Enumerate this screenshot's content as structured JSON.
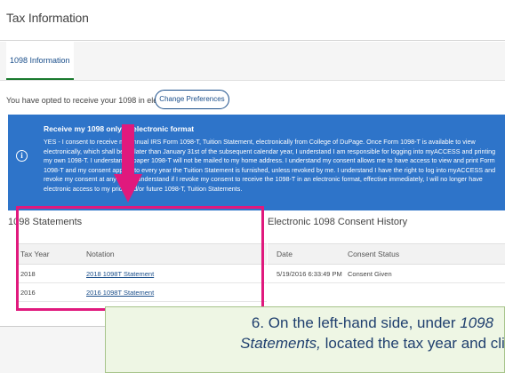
{
  "header": {
    "title": "Tax Information"
  },
  "tabs": [
    {
      "label": "1098 Information"
    }
  ],
  "opt_in": {
    "text": "You have opted to receive your 1098 in electronic format:",
    "button_label": "Change Preferences"
  },
  "consent": {
    "icon": "info-icon",
    "heading": "Receive my 1098 only in electronic format",
    "body": "YES - I consent to receive my annual IRS Form 1098-T, Tuition Statement, electronically from College of DuPage. Once Form 1098-T is available to view electronically, which shall be no later than January 31st of the subsequent calendar year, I understand I am responsible for logging into myACCESS and printing my own 1098-T. I understand a paper 1098-T will not be mailed to my home address. I understand my consent allows me to have access to view and print Form 1098-T and my consent applies to every year the Tuition Statement is furnished, unless revoked by me. I understand I have the right to log into myACCESS and revoke my consent at any time. I understand if I revoke my consent to receive the 1098-T in an electronic format, effective immediately, I will no longer have electronic access to my prior and/or future 1098-T, Tuition Statements.",
    "background": "#2e74c9"
  },
  "statements": {
    "title": "1098 Statements",
    "columns": [
      "Tax Year",
      "Notation"
    ],
    "rows": [
      {
        "year": "2018",
        "notation": "2018 1098T Statement"
      },
      {
        "year": "2016",
        "notation": "2016 1098T Statement"
      }
    ]
  },
  "history": {
    "title": "Electronic 1098 Consent History",
    "columns": [
      "Date",
      "Consent Status"
    ],
    "rows": [
      {
        "date": "5/19/2016 6:33:49 PM",
        "status": "Consent Given"
      }
    ]
  },
  "callout": {
    "line1_prefix": "6. On the left-hand side, under ",
    "line1_italic": "1098",
    "line2_italic": "Statements,",
    "line2_suffix": " located the tax year and cli"
  },
  "colors": {
    "highlight": "#e0197d",
    "arrow": "#e0197d",
    "link": "#1a4e8a",
    "callout_bg": "#eef6e4"
  }
}
